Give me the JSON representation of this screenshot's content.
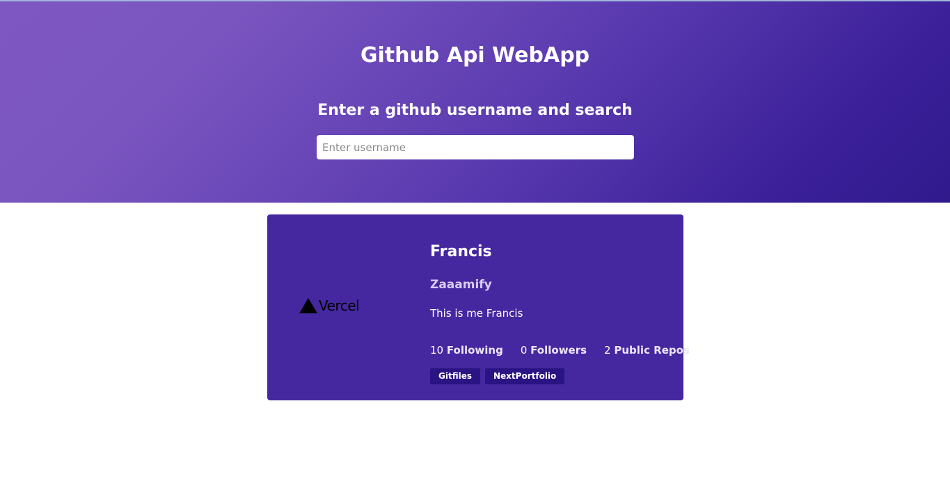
{
  "header": {
    "title": "Github Api WebApp",
    "search_heading": "Enter a github username and search",
    "search_placeholder": "Enter username",
    "search_value": ""
  },
  "profile": {
    "avatar_text": "Vercel",
    "name": "Francis",
    "login": "Zaaamify",
    "bio": "This is me Francis",
    "stats": [
      {
        "value": "10",
        "label": "Following"
      },
      {
        "value": "0",
        "label": "Followers"
      },
      {
        "value": "2",
        "label": "Public Repos"
      }
    ],
    "repos": [
      "Gitfiles",
      "NextPortfolio"
    ]
  }
}
